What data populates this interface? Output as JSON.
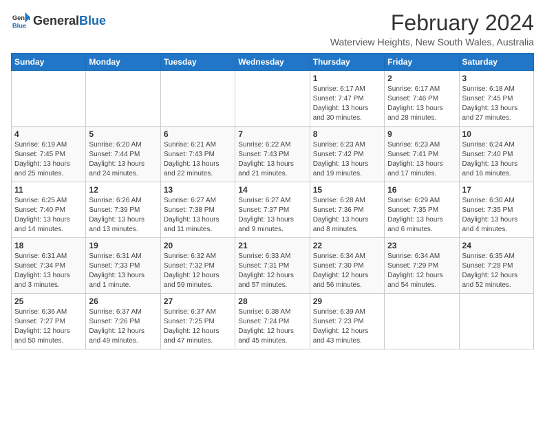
{
  "logo": {
    "text_general": "General",
    "text_blue": "Blue"
  },
  "title": "February 2024",
  "subtitle": "Waterview Heights, New South Wales, Australia",
  "days_of_week": [
    "Sunday",
    "Monday",
    "Tuesday",
    "Wednesday",
    "Thursday",
    "Friday",
    "Saturday"
  ],
  "weeks": [
    [
      {
        "day": "",
        "info": ""
      },
      {
        "day": "",
        "info": ""
      },
      {
        "day": "",
        "info": ""
      },
      {
        "day": "",
        "info": ""
      },
      {
        "day": "1",
        "info": "Sunrise: 6:17 AM\nSunset: 7:47 PM\nDaylight: 13 hours\nand 30 minutes."
      },
      {
        "day": "2",
        "info": "Sunrise: 6:17 AM\nSunset: 7:46 PM\nDaylight: 13 hours\nand 28 minutes."
      },
      {
        "day": "3",
        "info": "Sunrise: 6:18 AM\nSunset: 7:45 PM\nDaylight: 13 hours\nand 27 minutes."
      }
    ],
    [
      {
        "day": "4",
        "info": "Sunrise: 6:19 AM\nSunset: 7:45 PM\nDaylight: 13 hours\nand 25 minutes."
      },
      {
        "day": "5",
        "info": "Sunrise: 6:20 AM\nSunset: 7:44 PM\nDaylight: 13 hours\nand 24 minutes."
      },
      {
        "day": "6",
        "info": "Sunrise: 6:21 AM\nSunset: 7:43 PM\nDaylight: 13 hours\nand 22 minutes."
      },
      {
        "day": "7",
        "info": "Sunrise: 6:22 AM\nSunset: 7:43 PM\nDaylight: 13 hours\nand 21 minutes."
      },
      {
        "day": "8",
        "info": "Sunrise: 6:23 AM\nSunset: 7:42 PM\nDaylight: 13 hours\nand 19 minutes."
      },
      {
        "day": "9",
        "info": "Sunrise: 6:23 AM\nSunset: 7:41 PM\nDaylight: 13 hours\nand 17 minutes."
      },
      {
        "day": "10",
        "info": "Sunrise: 6:24 AM\nSunset: 7:40 PM\nDaylight: 13 hours\nand 16 minutes."
      }
    ],
    [
      {
        "day": "11",
        "info": "Sunrise: 6:25 AM\nSunset: 7:40 PM\nDaylight: 13 hours\nand 14 minutes."
      },
      {
        "day": "12",
        "info": "Sunrise: 6:26 AM\nSunset: 7:39 PM\nDaylight: 13 hours\nand 13 minutes."
      },
      {
        "day": "13",
        "info": "Sunrise: 6:27 AM\nSunset: 7:38 PM\nDaylight: 13 hours\nand 11 minutes."
      },
      {
        "day": "14",
        "info": "Sunrise: 6:27 AM\nSunset: 7:37 PM\nDaylight: 13 hours\nand 9 minutes."
      },
      {
        "day": "15",
        "info": "Sunrise: 6:28 AM\nSunset: 7:36 PM\nDaylight: 13 hours\nand 8 minutes."
      },
      {
        "day": "16",
        "info": "Sunrise: 6:29 AM\nSunset: 7:35 PM\nDaylight: 13 hours\nand 6 minutes."
      },
      {
        "day": "17",
        "info": "Sunrise: 6:30 AM\nSunset: 7:35 PM\nDaylight: 13 hours\nand 4 minutes."
      }
    ],
    [
      {
        "day": "18",
        "info": "Sunrise: 6:31 AM\nSunset: 7:34 PM\nDaylight: 13 hours\nand 3 minutes."
      },
      {
        "day": "19",
        "info": "Sunrise: 6:31 AM\nSunset: 7:33 PM\nDaylight: 13 hours\nand 1 minute."
      },
      {
        "day": "20",
        "info": "Sunrise: 6:32 AM\nSunset: 7:32 PM\nDaylight: 12 hours\nand 59 minutes."
      },
      {
        "day": "21",
        "info": "Sunrise: 6:33 AM\nSunset: 7:31 PM\nDaylight: 12 hours\nand 57 minutes."
      },
      {
        "day": "22",
        "info": "Sunrise: 6:34 AM\nSunset: 7:30 PM\nDaylight: 12 hours\nand 56 minutes."
      },
      {
        "day": "23",
        "info": "Sunrise: 6:34 AM\nSunset: 7:29 PM\nDaylight: 12 hours\nand 54 minutes."
      },
      {
        "day": "24",
        "info": "Sunrise: 6:35 AM\nSunset: 7:28 PM\nDaylight: 12 hours\nand 52 minutes."
      }
    ],
    [
      {
        "day": "25",
        "info": "Sunrise: 6:36 AM\nSunset: 7:27 PM\nDaylight: 12 hours\nand 50 minutes."
      },
      {
        "day": "26",
        "info": "Sunrise: 6:37 AM\nSunset: 7:26 PM\nDaylight: 12 hours\nand 49 minutes."
      },
      {
        "day": "27",
        "info": "Sunrise: 6:37 AM\nSunset: 7:25 PM\nDaylight: 12 hours\nand 47 minutes."
      },
      {
        "day": "28",
        "info": "Sunrise: 6:38 AM\nSunset: 7:24 PM\nDaylight: 12 hours\nand 45 minutes."
      },
      {
        "day": "29",
        "info": "Sunrise: 6:39 AM\nSunset: 7:23 PM\nDaylight: 12 hours\nand 43 minutes."
      },
      {
        "day": "",
        "info": ""
      },
      {
        "day": "",
        "info": ""
      }
    ]
  ]
}
